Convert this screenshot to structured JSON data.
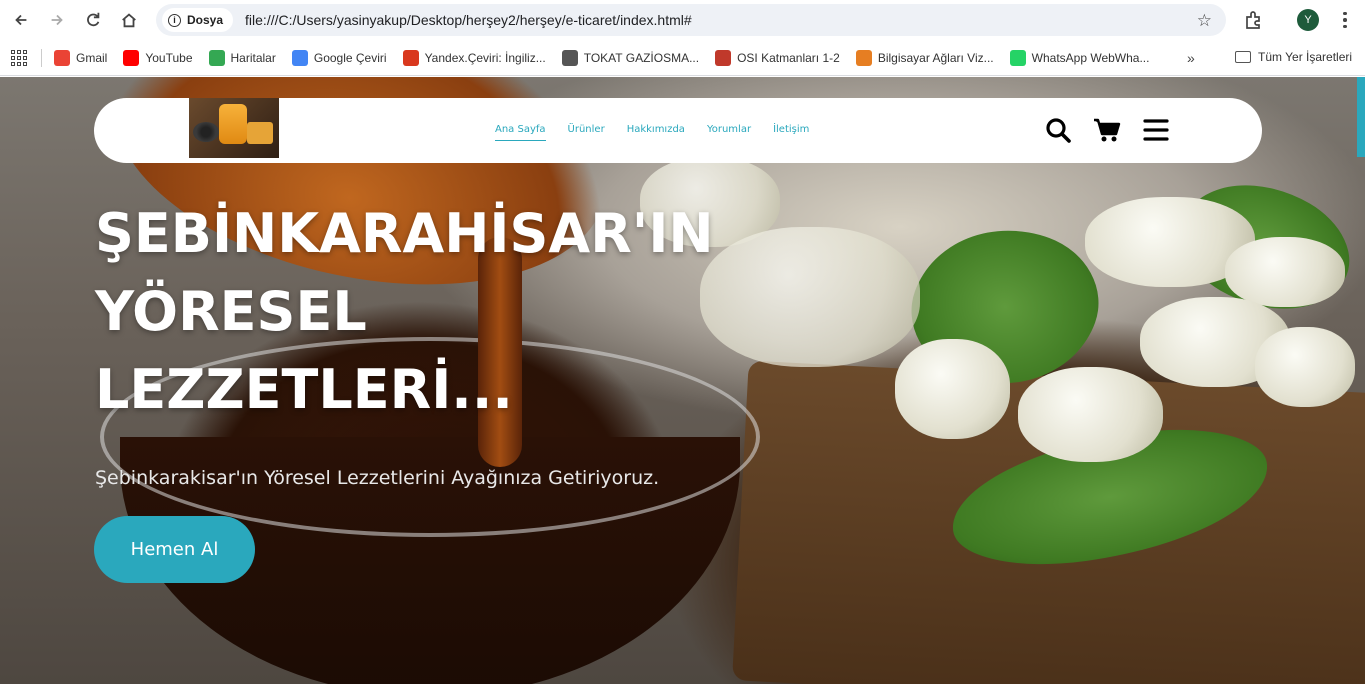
{
  "browser": {
    "site_chip": "Dosya",
    "url": "file:///C:/Users/yasinyakup/Desktop/herşey2/herşey/e-ticaret/index.html#",
    "profile_initial": "Y"
  },
  "bookmarks": [
    {
      "label": "Gmail",
      "color": "#ea4335"
    },
    {
      "label": "YouTube",
      "color": "#ff0000"
    },
    {
      "label": "Haritalar",
      "color": "#34a853"
    },
    {
      "label": "Google Çeviri",
      "color": "#4285f4"
    },
    {
      "label": "Yandex.Çeviri: İngiliz...",
      "color": "#d9381e"
    },
    {
      "label": "TOKAT GAZİOSMA...",
      "color": "#555555"
    },
    {
      "label": "OSI Katmanları 1-2",
      "color": "#c0392b"
    },
    {
      "label": "Bilgisayar Ağları Viz...",
      "color": "#e67e22"
    },
    {
      "label": "WhatsApp WebWha...",
      "color": "#25d366"
    }
  ],
  "bookmarks_more": "»",
  "all_bookmarks": "Tüm Yer İşaretleri",
  "site": {
    "nav": [
      "Ana Sayfa",
      "Ürünler",
      "Hakkımızda",
      "Yorumlar",
      "İletişim"
    ],
    "hero_title": "ŞEBİNKARAHİSAR'IN YÖRESEL LEZZETLERİ...",
    "hero_subtitle": "Şebinkarakisar'ın Yöresel Lezzetlerini Ayağınıza Getiriyoruz.",
    "cta_label": "Hemen Al",
    "accent": "#2aa8bd"
  }
}
